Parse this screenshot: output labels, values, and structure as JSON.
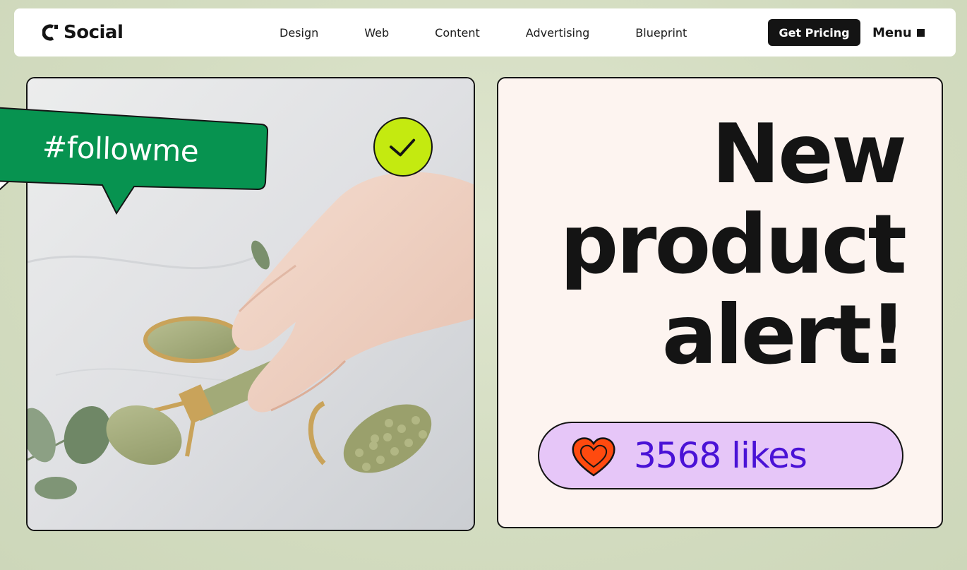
{
  "brand": {
    "name": "Social"
  },
  "nav": {
    "items": [
      "Design",
      "Web",
      "Content",
      "Advertising",
      "Blueprint"
    ]
  },
  "header": {
    "cta_label": "Get Pricing",
    "menu_label": "Menu"
  },
  "hero": {
    "bubble_text": "#followme",
    "headline_lines": [
      "New",
      "product",
      "alert!"
    ],
    "likes_label": "3568 likes"
  },
  "colors": {
    "background": "#d3dcc0",
    "bubble_green": "#079350",
    "check_lime": "#c4ea10",
    "panel_cream": "#fdf4f0",
    "likes_bg": "#e6c6f8",
    "likes_text": "#4a12d6",
    "heart": "#ff4a0f"
  },
  "icons": {
    "logo": "logo-mark-icon",
    "menu": "square-icon",
    "badge": "check-icon",
    "likes": "heart-icon"
  }
}
